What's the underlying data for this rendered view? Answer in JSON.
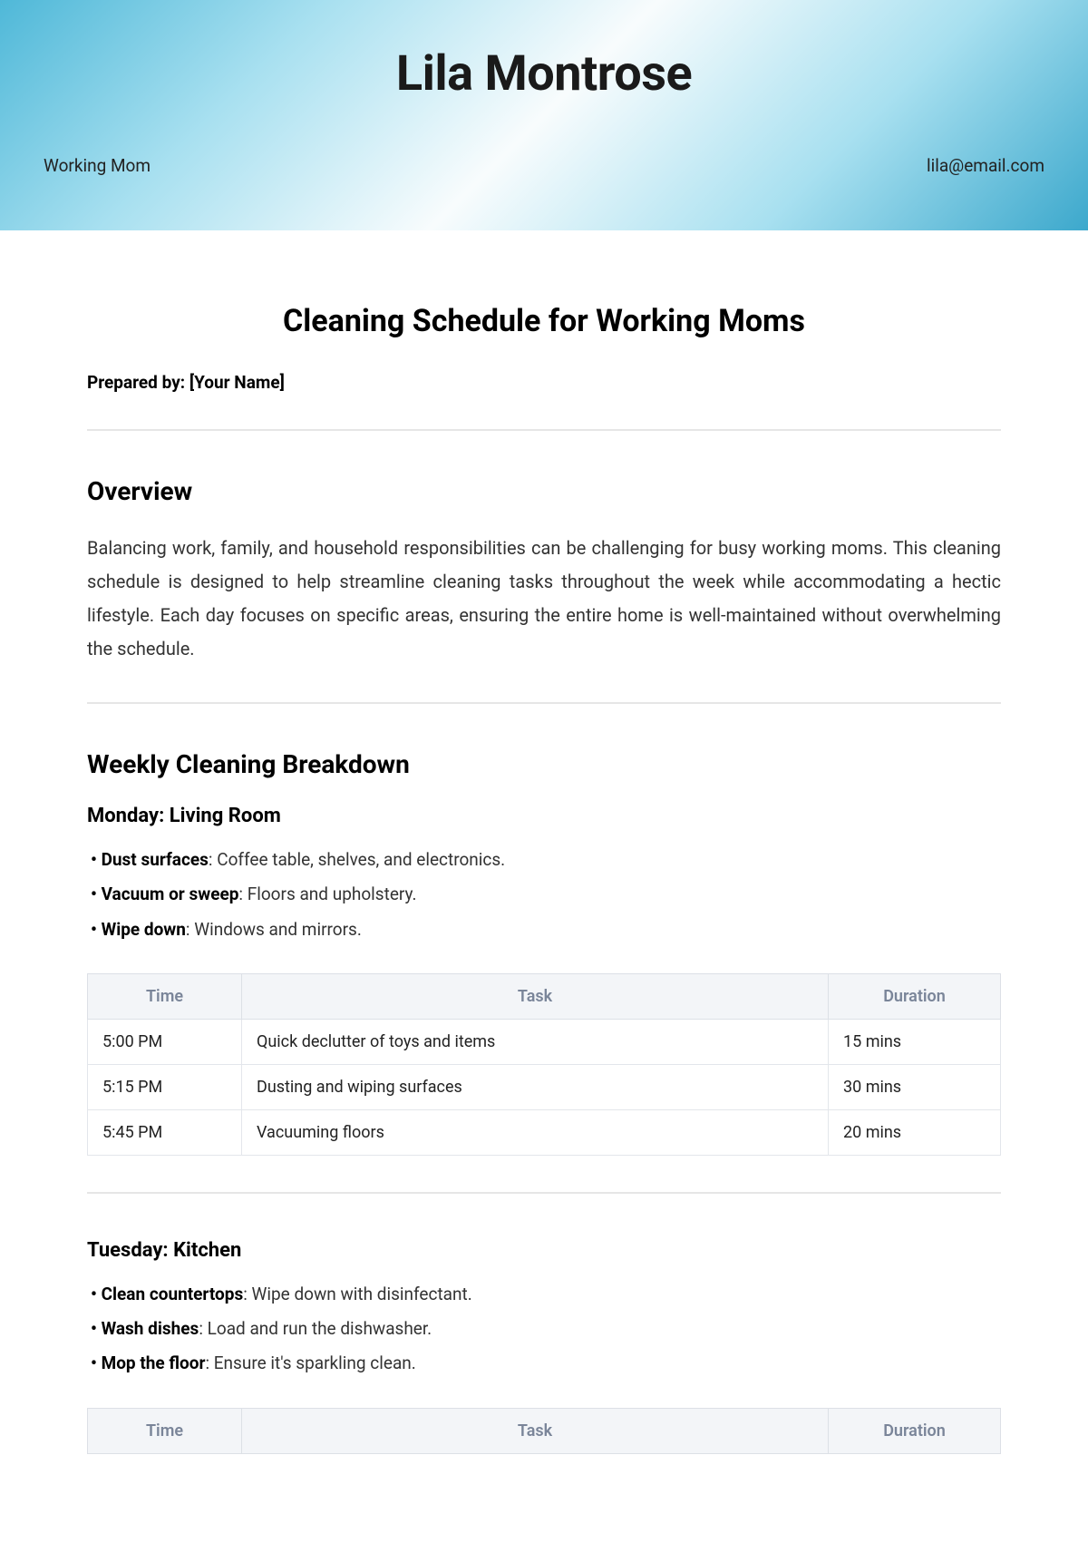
{
  "header": {
    "name": "Lila Montrose",
    "role": "Working Mom",
    "email": "lila@email.com"
  },
  "doc": {
    "title": "Cleaning Schedule for Working Moms",
    "prepared_by": "Prepared by: [Your Name]"
  },
  "overview": {
    "heading": "Overview",
    "body": "Balancing work, family, and household responsibilities can be challenging for busy working moms. This cleaning schedule is designed to help streamline cleaning tasks throughout the week while accommodating a hectic lifestyle. Each day focuses on specific areas, ensuring the entire home is well-maintained without overwhelming the schedule."
  },
  "breakdown": {
    "heading": "Weekly Cleaning Breakdown",
    "table_headers": {
      "time": "Time",
      "task": "Task",
      "duration": "Duration"
    },
    "monday": {
      "title": "Monday: Living Room",
      "bullets": [
        {
          "label": "Dust surfaces",
          "desc": ": Coffee table, shelves, and electronics."
        },
        {
          "label": "Vacuum or sweep",
          "desc": ": Floors and upholstery."
        },
        {
          "label": "Wipe down",
          "desc": ": Windows and mirrors."
        }
      ],
      "rows": [
        {
          "time": "5:00 PM",
          "task": "Quick declutter of toys and items",
          "duration": "15 mins"
        },
        {
          "time": "5:15 PM",
          "task": "Dusting and wiping surfaces",
          "duration": "30 mins"
        },
        {
          "time": "5:45 PM",
          "task": "Vacuuming floors",
          "duration": "20 mins"
        }
      ]
    },
    "tuesday": {
      "title": "Tuesday: Kitchen",
      "bullets": [
        {
          "label": "Clean countertops",
          "desc": ": Wipe down with disinfectant."
        },
        {
          "label": "Wash dishes",
          "desc": ": Load and run the dishwasher."
        },
        {
          "label": "Mop the floor",
          "desc": ": Ensure it's sparkling clean."
        }
      ]
    }
  }
}
